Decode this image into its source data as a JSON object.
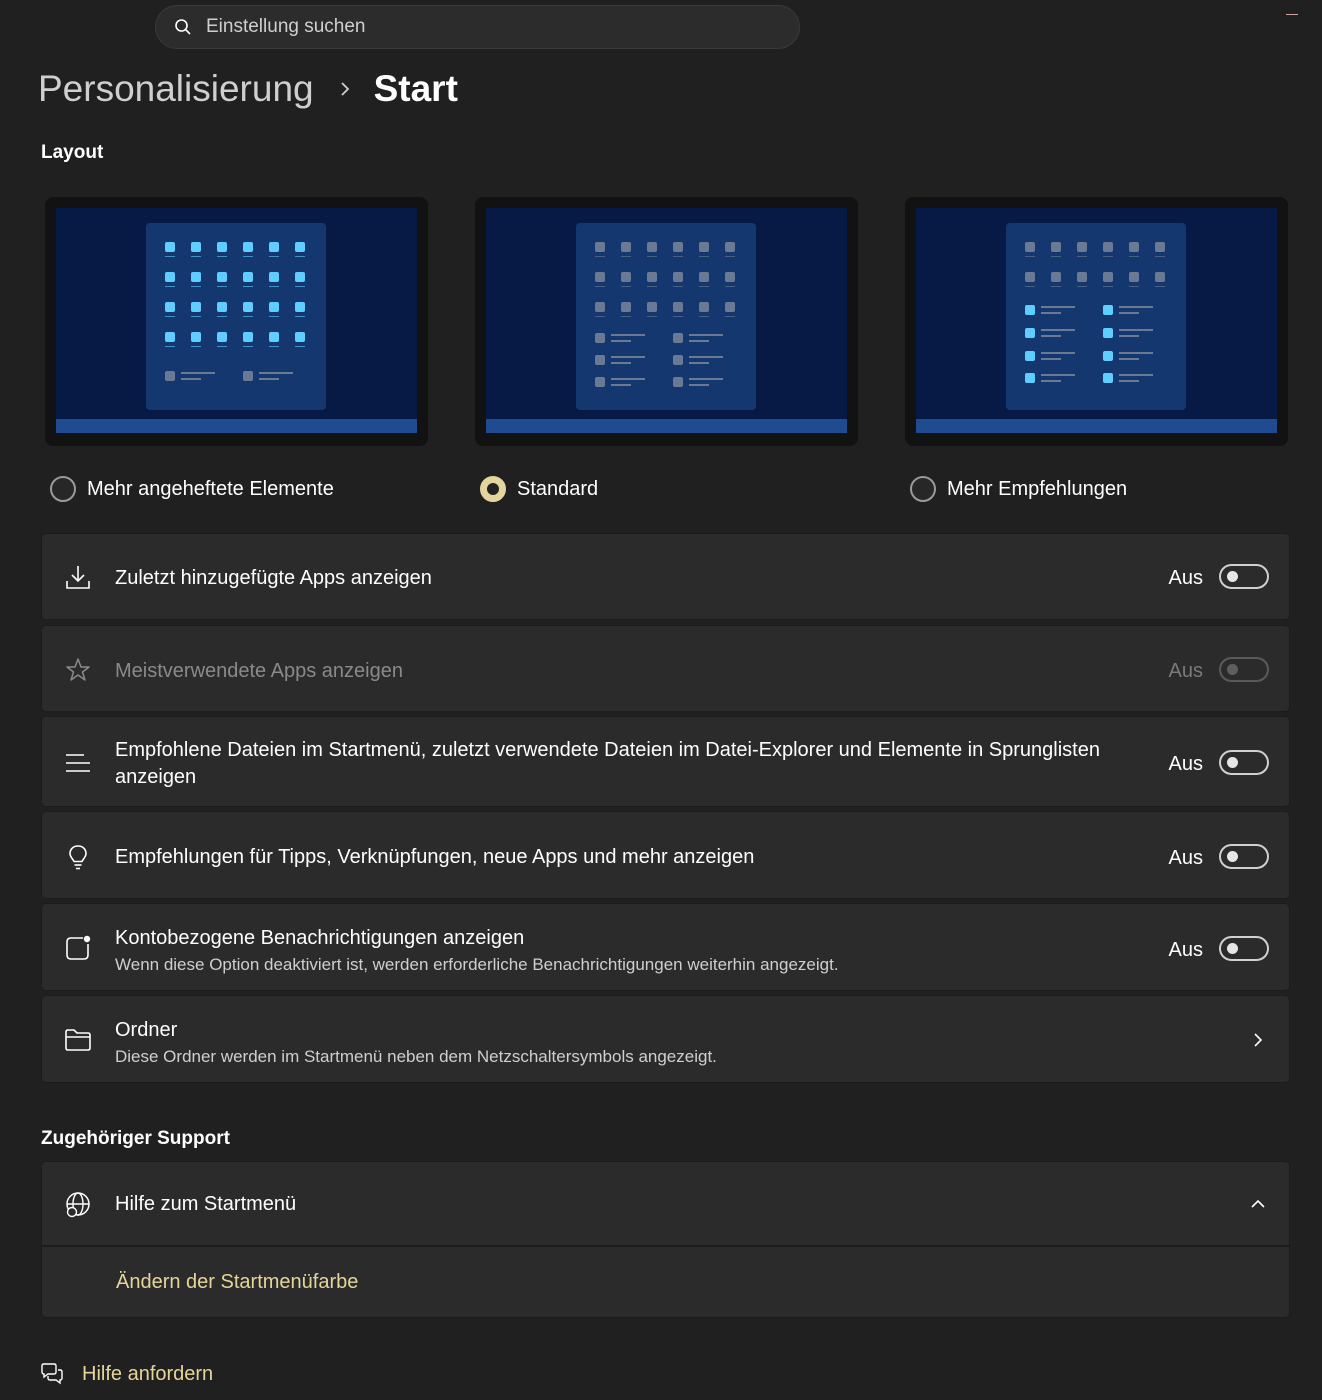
{
  "search": {
    "placeholder": "Einstellung suchen"
  },
  "breadcrumb": {
    "parent": "Personalisierung",
    "current": "Start"
  },
  "layout": {
    "title": "Layout",
    "options": [
      {
        "label": "Mehr angeheftete Elemente",
        "selected": false
      },
      {
        "label": "Standard",
        "selected": true
      },
      {
        "label": "Mehr Empfehlungen",
        "selected": false
      }
    ]
  },
  "settings": [
    {
      "title": "Zuletzt hinzugefügte Apps anzeigen",
      "state": "Aus",
      "icon": "download-icon",
      "enabled": true
    },
    {
      "title": "Meistverwendete Apps anzeigen",
      "state": "Aus",
      "icon": "star-icon",
      "enabled": false
    },
    {
      "title": "Empfohlene Dateien im Startmenü, zuletzt verwendete Dateien im Datei-Explorer und Elemente in Sprunglisten anzeigen",
      "state": "Aus",
      "icon": "list-icon",
      "enabled": true
    },
    {
      "title": "Empfehlungen für Tipps, Verknüpfungen, neue Apps und mehr anzeigen",
      "state": "Aus",
      "icon": "lightbulb-icon",
      "enabled": true
    },
    {
      "title": "Kontobezogene Benachrichtigungen anzeigen",
      "description": "Wenn diese Option deaktiviert ist, werden erforderliche Benachrichtigungen weiterhin angezeigt.",
      "state": "Aus",
      "icon": "notification-icon",
      "enabled": true
    },
    {
      "title": "Ordner",
      "description": "Diese Ordner werden im Startmenü neben dem Netzschaltersymbols angezeigt.",
      "icon": "folder-icon"
    }
  ],
  "support": {
    "title": "Zugehöriger Support",
    "help_title": "Hilfe zum Startmenü",
    "help_link": "Ändern der Startmenüfarbe",
    "get_help": "Hilfe anfordern"
  },
  "colors": {
    "background": "#202020",
    "card": "#2b2b2b",
    "accent": "#e3d59c",
    "tile_bright": "#60cdff",
    "tile_muted": "#6b7a92"
  }
}
